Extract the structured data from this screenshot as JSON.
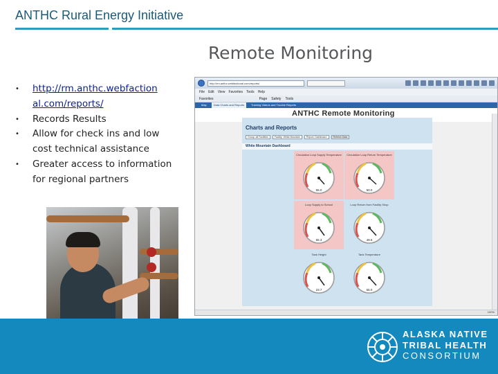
{
  "header": {
    "title": "ANTHC Rural Energy Initiative"
  },
  "slide": {
    "title": "Remote Monitoring",
    "bullets": [
      {
        "text": "http://rm.anthc.webfaction\nal.com/reports/",
        "is_link": true
      },
      {
        "text": "Records Results"
      },
      {
        "text": "Allow for check ins and low cost technical assistance"
      },
      {
        "text": "Greater access to information for regional partners"
      }
    ]
  },
  "screenshot": {
    "address": "http://rm.anthc.webfactional.com/reports/",
    "menu": [
      "File",
      "Edit",
      "View",
      "Favorites",
      "Tools",
      "Help"
    ],
    "command_bar": [
      "Favorites",
      "Page",
      "Safety",
      "Tools"
    ],
    "tabs": [
      "Map",
      "Data Charts and Reports",
      "Training Videos and Trouble Reports"
    ],
    "site_title": "ANTHC Remote Monitoring",
    "section_title": "Charts and Reports",
    "controls": {
      "group": "Group: all Facilities",
      "facility": "Facility: White Mountain",
      "report": "Report: Dashboard",
      "refresh": "Refresh Data"
    },
    "dashboard_title": "White Mountain Dashboard",
    "gauges": [
      {
        "label": "Circulation Loop Supply Temperature",
        "reading": "55.0",
        "highlight": true
      },
      {
        "label": "Circulation Loop Return Temperature",
        "reading": "50.0",
        "highlight": true
      },
      {
        "label": "Loop Supply to School",
        "reading": "55.3",
        "highlight": true
      },
      {
        "label": "Loop Return from Facility Shop",
        "reading": "49.5",
        "highlight": false
      },
      {
        "label": "Tank Height",
        "reading": "23.7",
        "highlight": false
      },
      {
        "label": "Tank Temperature",
        "reading": "55.0",
        "highlight": false
      }
    ],
    "zoom": "100%"
  },
  "footer": {
    "logo_lines": [
      "ALASKA NATIVE",
      "TRIBAL HEALTH",
      "CONSORTIUM"
    ]
  },
  "colors": {
    "brand_blue": "#1489be",
    "title_color": "#1a5a78",
    "highlight_panel": "#f4c6c6",
    "dashboard_bg": "#cfe2f0"
  }
}
